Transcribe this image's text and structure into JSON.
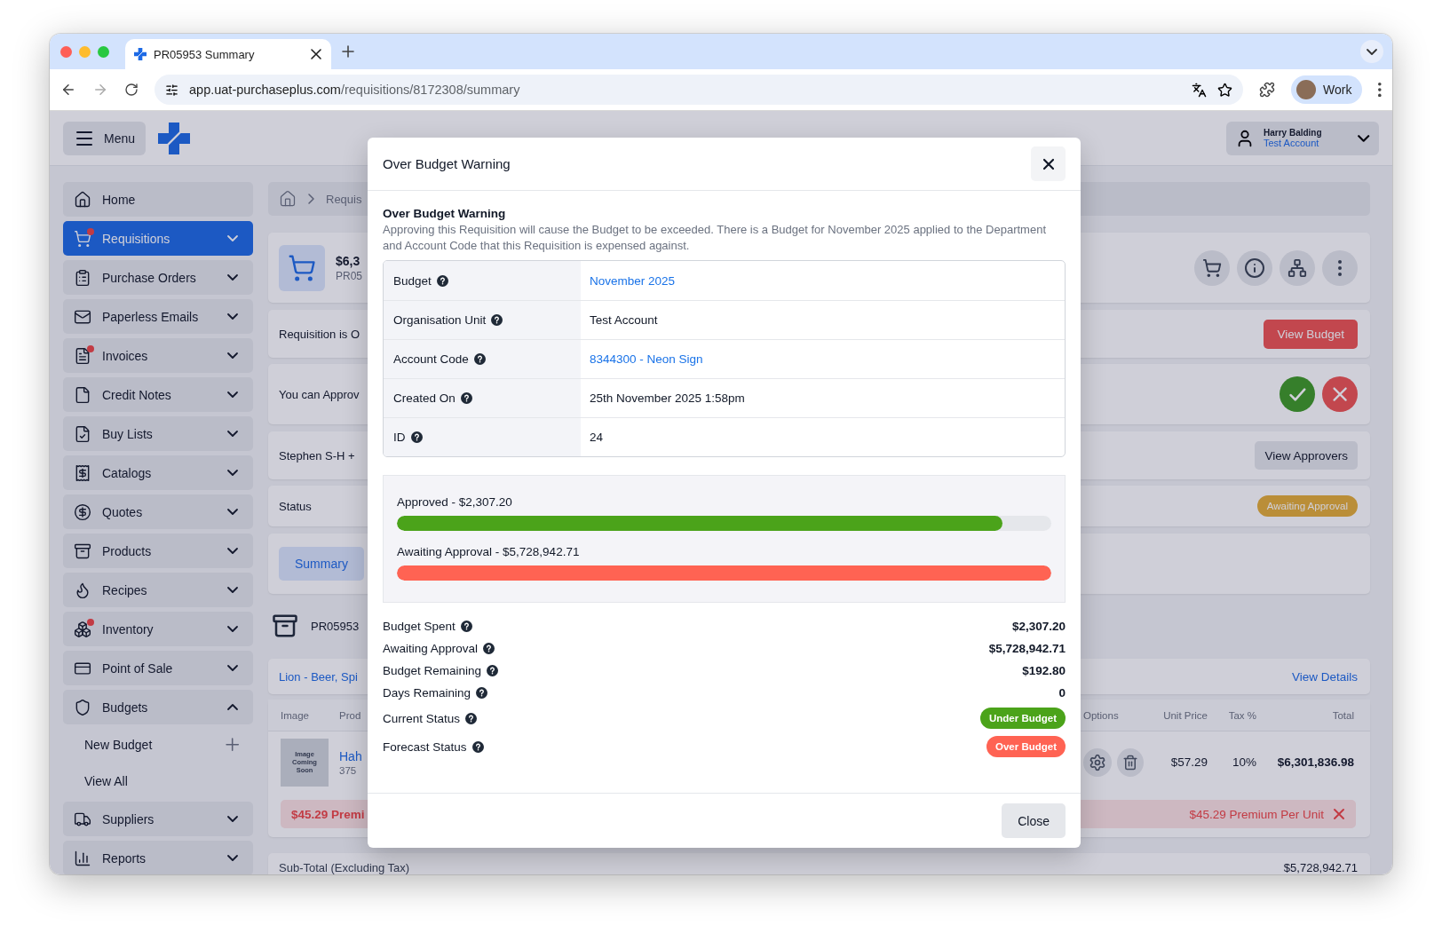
{
  "browser": {
    "tab_title": "PR05953 Summary",
    "url_host": "app.uat-purchaseplus.com",
    "url_path": "/requisitions/8172308/summary",
    "profile": "Work"
  },
  "header": {
    "menu_label": "Menu",
    "user_name": "Harry Balding",
    "user_account": "Test Account"
  },
  "sidebar": {
    "items": [
      {
        "label": "Home",
        "kind": "link",
        "selected": false,
        "badge": false
      },
      {
        "label": "Requisitions",
        "kind": "group",
        "selected": true,
        "expanded": false,
        "badge": true
      },
      {
        "label": "Purchase Orders",
        "kind": "group",
        "selected": false,
        "expanded": false,
        "badge": false
      },
      {
        "label": "Paperless Emails",
        "kind": "group",
        "selected": false,
        "expanded": false,
        "badge": false
      },
      {
        "label": "Invoices",
        "kind": "group",
        "selected": false,
        "expanded": false,
        "badge": true
      },
      {
        "label": "Credit Notes",
        "kind": "group",
        "selected": false,
        "expanded": false,
        "badge": false
      },
      {
        "label": "Buy Lists",
        "kind": "group",
        "selected": false,
        "expanded": false,
        "badge": false
      },
      {
        "label": "Catalogs",
        "kind": "group",
        "selected": false,
        "expanded": false,
        "badge": false
      },
      {
        "label": "Quotes",
        "kind": "group",
        "selected": false,
        "expanded": false,
        "badge": false
      },
      {
        "label": "Products",
        "kind": "group",
        "selected": false,
        "expanded": false,
        "badge": false
      },
      {
        "label": "Recipes",
        "kind": "group",
        "selected": false,
        "expanded": false,
        "badge": false
      },
      {
        "label": "Inventory",
        "kind": "group",
        "selected": false,
        "expanded": false,
        "badge": true
      },
      {
        "label": "Point of Sale",
        "kind": "group",
        "selected": false,
        "expanded": false,
        "badge": false
      },
      {
        "label": "Budgets",
        "kind": "group",
        "selected": false,
        "expanded": true,
        "badge": false,
        "children": [
          {
            "label": "New Budget",
            "kind": "add"
          },
          {
            "label": "View All",
            "kind": "link"
          }
        ]
      },
      {
        "label": "Suppliers",
        "kind": "group",
        "selected": false,
        "expanded": false,
        "badge": false
      },
      {
        "label": "Reports",
        "kind": "group",
        "selected": false,
        "expanded": false,
        "badge": false
      }
    ]
  },
  "breadcrumb": [
    "Requis"
  ],
  "summary": {
    "amount": "$6,3",
    "number": "PR05"
  },
  "budget_notice": {
    "text": "Requisition is O",
    "button": "View Budget"
  },
  "approval": {
    "text": "You can Approv"
  },
  "approvers": {
    "text": "Stephen S-H +",
    "button": "View Approvers"
  },
  "status": {
    "label": "Status",
    "badge": "Awaiting Approval"
  },
  "tabs": [
    {
      "label": "Summary",
      "selected": true
    }
  ],
  "section_title": "PR05953",
  "supplier": {
    "name": "Lion - Beer, Spi",
    "link": "View Details"
  },
  "table": {
    "columns": [
      "Image",
      "Prod",
      "Options",
      "Unit Price",
      "Tax %",
      "Total"
    ],
    "rows": [
      {
        "image_text": "Image Coming Soon",
        "product": "Hah",
        "quantity": "375",
        "unit_price": "$57.29",
        "tax": "10%",
        "total": "$6,301,836.98",
        "warning_left": "$45.29 Premi",
        "warning": "$45.29 Premium Per Unit"
      }
    ]
  },
  "subtotal": {
    "label": "Sub-Total (Excluding Tax)",
    "value": "$5,728,942.71"
  },
  "modal": {
    "title": "Over Budget Warning",
    "warning_title": "Over Budget Warning",
    "warning_text": "Approving this Requisition will cause the Budget to be exceeded. There is a Budget for November 2025 applied to the Department and Account Code that this Requisition is expensed against.",
    "details": [
      {
        "label": "Budget",
        "value": "November 2025",
        "link": true
      },
      {
        "label": "Organisation Unit",
        "value": "Test Account",
        "link": false
      },
      {
        "label": "Account Code",
        "value": "8344300 - Neon Sign",
        "link": true
      },
      {
        "label": "Created On",
        "value": "25th November 2025 1:58pm",
        "link": false
      },
      {
        "label": "ID",
        "value": "24",
        "link": false
      }
    ],
    "progress": [
      {
        "label": "Approved - $2,307.20",
        "level": 0.925,
        "color": "#4ba31a"
      },
      {
        "label": "Awaiting Approval - $5,728,942.71",
        "level": 1,
        "color": "#ff6353"
      }
    ],
    "stats": [
      {
        "label": "Budget Spent",
        "value": "$2,307.20"
      },
      {
        "label": "Awaiting Approval",
        "value": "$5,728,942.71"
      },
      {
        "label": "Budget Remaining",
        "value": "$192.80"
      },
      {
        "label": "Days Remaining",
        "value": "0"
      }
    ],
    "statuses": [
      {
        "label": "Current Status",
        "badge": "Under Budget",
        "color": "#4ba31a"
      },
      {
        "label": "Forecast Status",
        "badge": "Over Budget",
        "color": "#ff6353"
      }
    ],
    "close_button": "Close"
  }
}
